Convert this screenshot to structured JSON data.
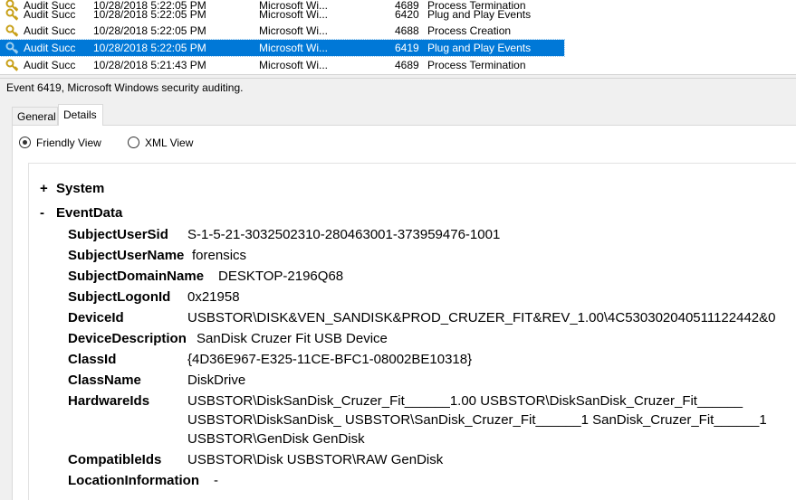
{
  "event_list": {
    "rows": [
      {
        "level": "Audit Succ",
        "date": "10/28/2018 5:22:05 PM",
        "source": "Microsoft Wi...",
        "id": "4689",
        "task": "Process Termination",
        "selected": false
      },
      {
        "level": "Audit Succ",
        "date": "10/28/2018 5:22:05 PM",
        "source": "Microsoft Wi...",
        "id": "6420",
        "task": "Plug and Play Events",
        "selected": false
      },
      {
        "level": "Audit Succ",
        "date": "10/28/2018 5:22:05 PM",
        "source": "Microsoft Wi...",
        "id": "4688",
        "task": "Process Creation",
        "selected": false
      },
      {
        "level": "Audit Succ",
        "date": "10/28/2018 5:22:05 PM",
        "source": "Microsoft Wi...",
        "id": "6419",
        "task": "Plug and Play Events",
        "selected": true
      },
      {
        "level": "Audit Succ",
        "date": "10/28/2018 5:21:43 PM",
        "source": "Microsoft Wi...",
        "id": "4689",
        "task": "Process Termination",
        "selected": false
      }
    ]
  },
  "details": {
    "title": "Event 6419, Microsoft Windows security auditing.",
    "tabs": {
      "general": "General",
      "details": "Details"
    },
    "views": {
      "friendly": "Friendly View",
      "xml": "XML View",
      "selected": "friendly"
    },
    "sections": {
      "system": {
        "toggle": "+",
        "label": "System"
      },
      "eventdata": {
        "toggle": "-",
        "label": "EventData"
      }
    },
    "fields": {
      "SubjectUserSid": {
        "name": "SubjectUserSid",
        "value": "S-1-5-21-3032502310-280463001-373959476-1001"
      },
      "SubjectUserName": {
        "name": "SubjectUserName",
        "value": "forensics"
      },
      "SubjectDomainName": {
        "name": "SubjectDomainName",
        "value": "DESKTOP-2196Q68"
      },
      "SubjectLogonId": {
        "name": "SubjectLogonId",
        "value": "0x21958"
      },
      "DeviceId": {
        "name": "DeviceId",
        "value": "USBSTOR\\DISK&VEN_SANDISK&PROD_CRUZER_FIT&REV_1.00\\4C530302040511122442&0"
      },
      "DeviceDescription": {
        "name": "DeviceDescription",
        "value": "SanDisk Cruzer Fit USB Device"
      },
      "ClassId": {
        "name": "ClassId",
        "value": "{4D36E967-E325-11CE-BFC1-08002BE10318}"
      },
      "ClassName": {
        "name": "ClassName",
        "value": "DiskDrive"
      },
      "HardwareIds": {
        "name": "HardwareIds",
        "line1": "USBSTOR\\DiskSanDisk_Cruzer_Fit______1.00 USBSTOR\\DiskSanDisk_Cruzer_Fit______",
        "line2": "USBSTOR\\DiskSanDisk_ USBSTOR\\SanDisk_Cruzer_Fit______1 SanDisk_Cruzer_Fit______1",
        "line3": "USBSTOR\\GenDisk GenDisk"
      },
      "CompatibleIds": {
        "name": "CompatibleIds",
        "value": "USBSTOR\\Disk USBSTOR\\RAW GenDisk"
      },
      "LocationInformation": {
        "name": "LocationInformation",
        "value": "-"
      }
    }
  }
}
